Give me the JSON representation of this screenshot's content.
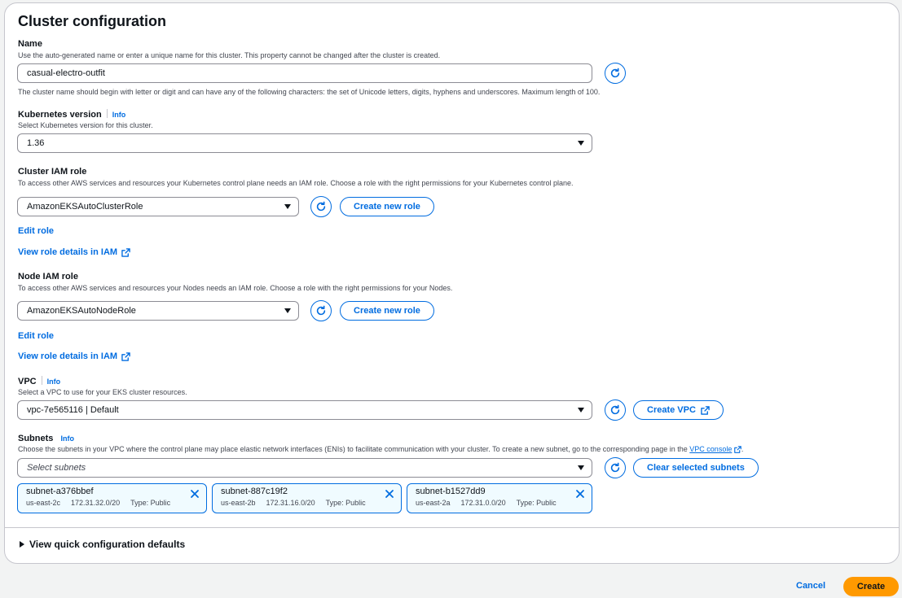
{
  "panel": {
    "title": "Cluster configuration"
  },
  "name": {
    "label": "Name",
    "description": "Use the auto-generated name or enter a unique name for this cluster. This property cannot be changed after the cluster is created.",
    "value": "casual-electro-outfit",
    "constraint": "The cluster name should begin with letter or digit and can have any of the following characters: the set of Unicode letters, digits, hyphens and underscores. Maximum length of 100."
  },
  "k8s_version": {
    "label": "Kubernetes version",
    "info": "Info",
    "description": "Select Kubernetes version for this cluster.",
    "value": "1.36"
  },
  "cluster_role": {
    "label": "Cluster IAM role",
    "description": "To access other AWS services and resources your Kubernetes control plane needs an IAM role. Choose a role with the right permissions for your Kubernetes control plane.",
    "value": "AmazonEKSAutoClusterRole",
    "create_label": "Create new role",
    "edit_label": "Edit role",
    "view_label": "View role details in IAM"
  },
  "node_role": {
    "label": "Node IAM role",
    "description": "To access other AWS services and resources your Nodes needs an IAM role. Choose a role with the right permissions for your Nodes.",
    "value": "AmazonEKSAutoNodeRole",
    "create_label": "Create new role",
    "edit_label": "Edit role",
    "view_label": "View role details in IAM"
  },
  "vpc": {
    "label": "VPC",
    "info": "Info",
    "description": "Select a VPC to use for your EKS cluster resources.",
    "value": "vpc-7e565116 | Default",
    "create_label": "Create VPC"
  },
  "subnets": {
    "label": "Subnets",
    "info": "Info",
    "description": "Choose the subnets in your VPC where the control plane may place elastic network interfaces (ENIs) to facilitate communication with your cluster. To create a new subnet, go to the corresponding page in the",
    "console_link": "VPC console",
    "description_end": ".",
    "placeholder": "Select subnets",
    "clear_label": "Clear selected subnets",
    "selected": [
      {
        "name": "subnet-a376bbef",
        "az": "us-east-2c",
        "cidr": "172.31.32.0/20",
        "type": "Type: Public"
      },
      {
        "name": "subnet-887c19f2",
        "az": "us-east-2b",
        "cidr": "172.31.16.0/20",
        "type": "Type: Public"
      },
      {
        "name": "subnet-b1527dd9",
        "az": "us-east-2a",
        "cidr": "172.31.0.0/20",
        "type": "Type: Public"
      }
    ]
  },
  "defaults": {
    "label": "View quick configuration defaults"
  },
  "footer": {
    "cancel_label": "Cancel",
    "create_label": "Create"
  },
  "colors": {
    "accent": "#006ce0",
    "primary_button": "#ff9900",
    "token_bg": "#f0fbff"
  },
  "icons": [
    "refresh-icon",
    "external-link-icon",
    "close-icon",
    "caret-down-icon",
    "expand-triangle-icon"
  ]
}
